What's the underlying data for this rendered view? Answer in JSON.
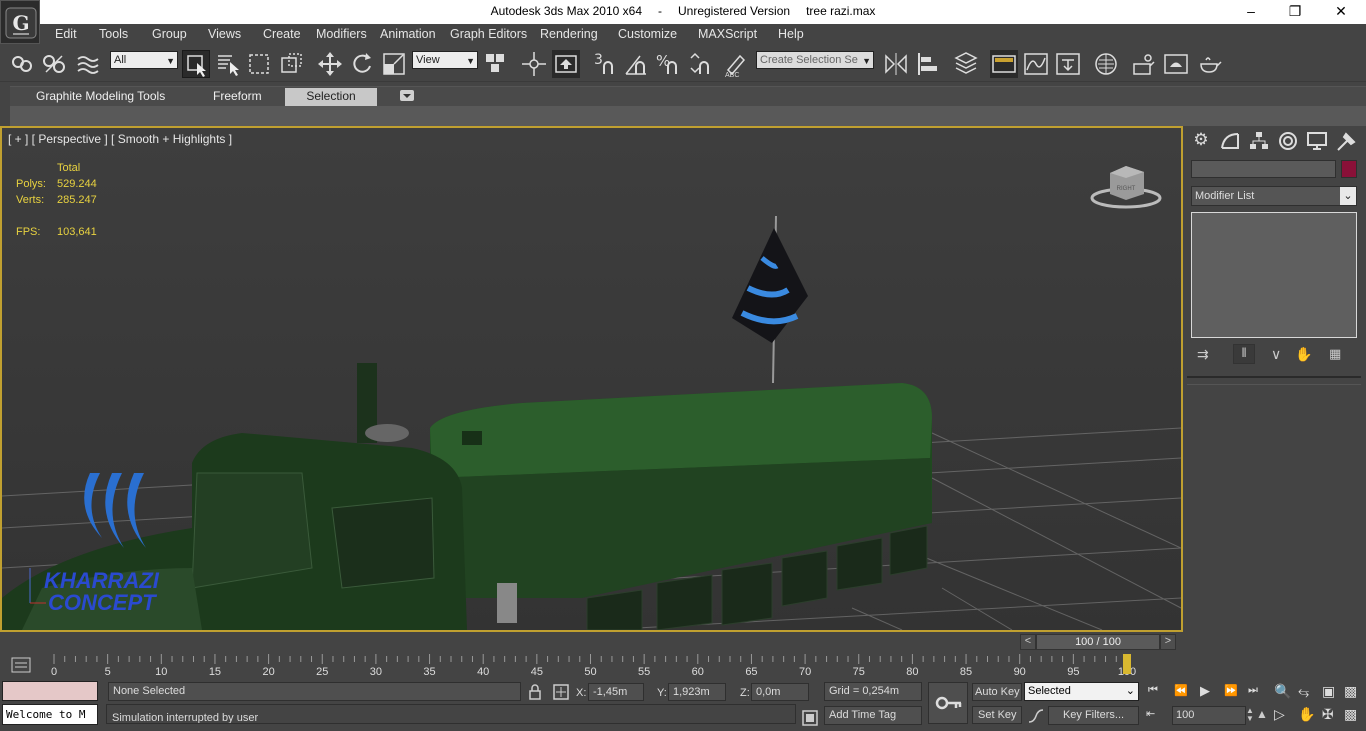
{
  "window": {
    "app_name": "Autodesk 3ds Max  2010 x64",
    "separator": "-",
    "version": "Unregistered Version",
    "file": "tree razi.max",
    "controls": [
      "minimize-icon",
      "restore-icon",
      "close-icon"
    ]
  },
  "menu": [
    "Edit",
    "Tools",
    "Group",
    "Views",
    "Create",
    "Modifiers",
    "Animation",
    "Graph Editors",
    "Rendering",
    "Customize",
    "MAXScript",
    "Help"
  ],
  "toolbar": {
    "selection_filter": "All",
    "reference_coord": "View",
    "snap_label": "3",
    "named_selection_placeholder": "Create Selection Se"
  },
  "ribbon": {
    "tabs": [
      "Graphite Modeling Tools",
      "Freeform",
      "Selection"
    ],
    "active_tab": "Selection"
  },
  "viewport": {
    "label": "[ + ] [ Perspective ] [ Smooth + Highlights ]",
    "stats": {
      "total_label": "Total",
      "polys_label": "Polys:",
      "polys_value": "529.244",
      "verts_label": "Verts:",
      "verts_value": "285.247",
      "fps_label": "FPS:",
      "fps_value": "103,641"
    },
    "watermark_text_1": "KHARRAZI",
    "watermark_text_2": "CONCEPT",
    "viewcube_face": "RIGHT"
  },
  "command_panel": {
    "tabs": [
      "create-icon",
      "modify-icon",
      "hierarchy-icon",
      "motion-icon",
      "display-icon",
      "utilities-icon"
    ],
    "object_color": "#8a1038",
    "modifier_list": "Modifier List"
  },
  "timeline": {
    "frame_display": "100 / 100",
    "ticks": [
      "0",
      "5",
      "10",
      "15",
      "20",
      "25",
      "30",
      "35",
      "40",
      "45",
      "50",
      "55",
      "60",
      "65",
      "70",
      "75",
      "80",
      "85",
      "90",
      "95",
      "100"
    ],
    "current_frame": 100
  },
  "status": {
    "maxscript_listener": "Welcome to M",
    "selection_status": "None Selected",
    "prompt": "Simulation interrupted by user",
    "x_label": "X:",
    "x_value": "-1,45m",
    "y_label": "Y:",
    "y_value": "1,923m",
    "z_label": "Z:",
    "z_value": "0,0m",
    "grid": "Grid = 0,254m",
    "add_time_tag": "Add Time Tag",
    "auto_key": "Auto Key",
    "set_key": "Set Key",
    "key_mode": "Selected",
    "key_filters": "Key Filters...",
    "frame_field": "100"
  }
}
